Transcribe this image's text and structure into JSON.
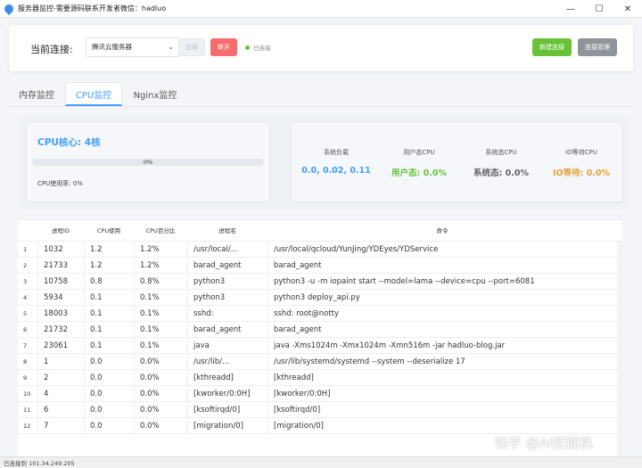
{
  "window": {
    "title": "服务器监控-需要源码联系开发者微信：hadluo",
    "minimize": "—",
    "maximize": "☐",
    "close": "✕"
  },
  "connection": {
    "label": "当前连接:",
    "selected_server": "腾讯云服务器",
    "connect_label": "连接",
    "disconnect_label": "断开",
    "status": "已连接",
    "new_connection_label": "新建连接",
    "manage_label": "连接管理"
  },
  "tabs": [
    {
      "label": "内存监控",
      "active": false
    },
    {
      "label": "CPU监控",
      "active": true
    },
    {
      "label": "Nginx监控",
      "active": false
    }
  ],
  "cpu_summary": {
    "cores_label": "CPU核心: 4核",
    "progress_percent": 0,
    "progress_text": "0%",
    "usage_text": "CPU使用率: 0%"
  },
  "stats": [
    {
      "label": "系统负载",
      "value": "0.0, 0.02, 0.11",
      "color": "#409eff"
    },
    {
      "label": "用户态CPU",
      "value": "用户态: 0.0%",
      "color": "#67c23a"
    },
    {
      "label": "系统态CPU",
      "value": "系统态: 0.0%",
      "color": "#606266"
    },
    {
      "label": "IO等待CPU",
      "value": "IO等待: 0.0%",
      "color": "#e6a23c"
    }
  ],
  "table": {
    "headers": [
      "",
      "进程ID",
      "CPU使用",
      "CPU百分比",
      "进程名",
      "命令"
    ],
    "rows": [
      [
        "1",
        "1032",
        "1.2",
        "1.2%",
        "/usr/local/...",
        "/usr/local/qcloud/YunJing/YDEyes/YDService"
      ],
      [
        "2",
        "21733",
        "1.2",
        "1.2%",
        "barad_agent",
        "barad_agent"
      ],
      [
        "3",
        "10758",
        "0.8",
        "0.8%",
        "python3",
        "python3 -u -m iopaint start --model=lama --device=cpu --port=6081"
      ],
      [
        "4",
        "5934",
        "0.1",
        "0.1%",
        "python3",
        "python3 deploy_api.py"
      ],
      [
        "5",
        "18003",
        "0.1",
        "0.1%",
        "sshd:",
        "sshd: root@notty"
      ],
      [
        "6",
        "21732",
        "0.1",
        "0.1%",
        "barad_agent",
        "barad_agent"
      ],
      [
        "7",
        "23061",
        "0.1",
        "0.1%",
        "java",
        "java -Xms1024m -Xmx1024m -Xmn516m -jar hadluo-blog.jar"
      ],
      [
        "8",
        "1",
        "0.0",
        "0.0%",
        "/usr/lib/...",
        "/usr/lib/systemd/systemd --system --deserialize 17"
      ],
      [
        "9",
        "2",
        "0.0",
        "0.0%",
        "[kthreadd]",
        "[kthreadd]"
      ],
      [
        "10",
        "4",
        "0.0",
        "0.0%",
        "[kworker/0:0H]",
        "[kworker/0:0H]"
      ],
      [
        "11",
        "6",
        "0.0",
        "0.0%",
        "[ksoftirqd/0]",
        "[ksoftirqd/0]"
      ],
      [
        "12",
        "7",
        "0.0",
        "0.0%",
        "[migration/0]",
        "[migration/0]"
      ]
    ]
  },
  "statusbar": {
    "text": "已连接到 101.34.249.205"
  },
  "watermark": "知乎 @AI挖掘机"
}
